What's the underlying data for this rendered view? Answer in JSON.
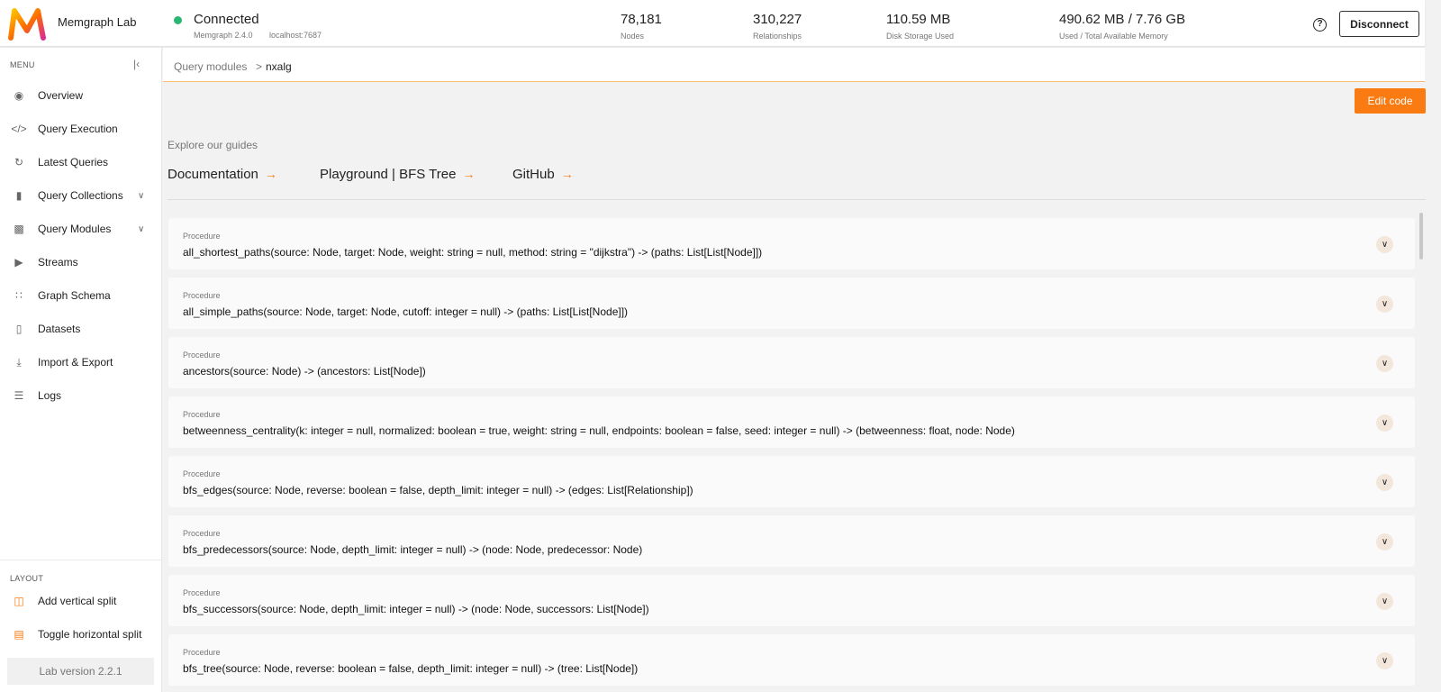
{
  "header": {
    "app_name": "Memgraph Lab",
    "connection_status": "Connected",
    "memgraph_version": "Memgraph 2.4.0",
    "host": "localhost:7687",
    "stats": [
      {
        "value": "78,181",
        "label": "Nodes"
      },
      {
        "value": "310,227",
        "label": "Relationships"
      },
      {
        "value": "110.59 MB",
        "label": "Disk Storage Used"
      },
      {
        "value": "490.62 MB / 7.76 GB",
        "label": "Used / Total Available Memory"
      }
    ],
    "help_icon": "?",
    "disconnect_label": "Disconnect",
    "colors": {
      "connected": "#2bb673",
      "accent": "#f97b12"
    }
  },
  "sidebar": {
    "menu_label": "MENU",
    "items": [
      {
        "label": "Overview",
        "icon": "eye-icon"
      },
      {
        "label": "Query Execution",
        "icon": "code-icon"
      },
      {
        "label": "Latest Queries",
        "icon": "history-icon"
      },
      {
        "label": "Query Collections",
        "icon": "folder-icon"
      },
      {
        "label": "Query Modules",
        "icon": "terminal-icon"
      },
      {
        "label": "Streams",
        "icon": "play-icon"
      },
      {
        "label": "Graph Schema",
        "icon": "schema-icon"
      },
      {
        "label": "Datasets",
        "icon": "book-icon"
      },
      {
        "label": "Import & Export",
        "icon": "download-icon"
      },
      {
        "label": "Logs",
        "icon": "list-icon"
      }
    ],
    "layout_label": "LAYOUT",
    "layout_items": [
      {
        "label": "Add vertical split",
        "icon": "vertical-split-icon"
      },
      {
        "label": "Toggle horizontal split",
        "icon": "horizontal-split-icon"
      }
    ],
    "version": "Lab version 2.2.1"
  },
  "breadcrumb": {
    "parent": "Query modules",
    "separator": ">",
    "current": "nxalg"
  },
  "main": {
    "edit_code_label": "Edit code",
    "guides_label": "Explore our guides",
    "guides": [
      "Documentation",
      "Playground | BFS Tree",
      "GitHub"
    ],
    "guide_arrow": "→",
    "procedures": [
      {
        "kind": "Procedure",
        "signature": "all_shortest_paths(source: Node, target: Node, weight: string = null, method: string = \"dijkstra\") -> (paths: List[List[Node]])"
      },
      {
        "kind": "Procedure",
        "signature": "all_simple_paths(source: Node, target: Node, cutoff: integer = null) -> (paths: List[List[Node]])"
      },
      {
        "kind": "Procedure",
        "signature": "ancestors(source: Node) -> (ancestors: List[Node])"
      },
      {
        "kind": "Procedure",
        "signature": "betweenness_centrality(k: integer = null, normalized: boolean = true, weight: string = null, endpoints: boolean = false, seed: integer = null) -> (betweenness: float, node: Node)"
      },
      {
        "kind": "Procedure",
        "signature": "bfs_edges(source: Node, reverse: boolean = false, depth_limit: integer = null) -> (edges: List[Relationship])"
      },
      {
        "kind": "Procedure",
        "signature": "bfs_predecessors(source: Node, depth_limit: integer = null) -> (node: Node, predecessor: Node)"
      },
      {
        "kind": "Procedure",
        "signature": "bfs_successors(source: Node, depth_limit: integer = null) -> (node: Node, successors: List[Node])"
      },
      {
        "kind": "Procedure",
        "signature": "bfs_tree(source: Node, reverse: boolean = false, depth_limit: integer = null) -> (tree: List[Node])"
      }
    ]
  }
}
